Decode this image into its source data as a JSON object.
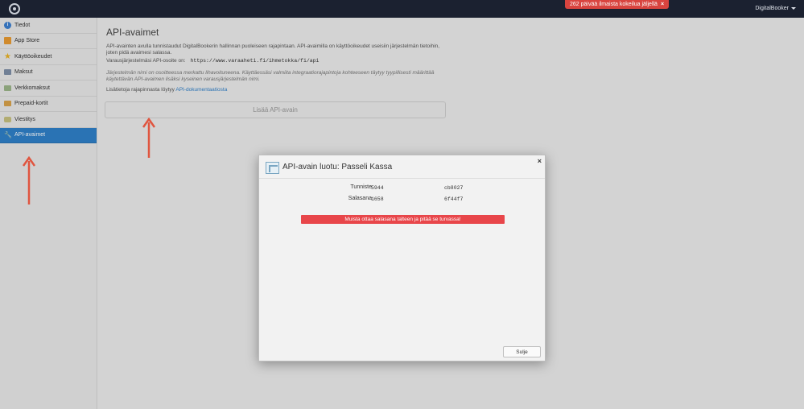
{
  "topbar": {
    "trial_notice": "262 päivää ilmaista kokeilua jäljellä",
    "trial_close": "×",
    "user_menu": "DigitalBooker"
  },
  "sidebar": {
    "items": [
      {
        "label": "Tiedot",
        "icon": "info-icon"
      },
      {
        "label": "App Store",
        "icon": "store-icon"
      },
      {
        "label": "Käyttöoikeudet",
        "icon": "star-icon"
      },
      {
        "label": "Maksut",
        "icon": "card-icon"
      },
      {
        "label": "Verkkomaksut",
        "icon": "card-icon"
      },
      {
        "label": "Prepaid-kortit",
        "icon": "card-icon"
      },
      {
        "label": "Viestitys",
        "icon": "message-icon"
      },
      {
        "label": "API-avaimet",
        "icon": "key-icon"
      }
    ]
  },
  "main": {
    "title": "API-avaimet",
    "intro": "API-avainten avulla tunnistaudut DigitalBookerin hallinnan puoleiseen rajapintaan. API-avaimilla on käyttöoikeudet useisiin järjestelmän tietoihin, joten pidä avaimesi salassa.",
    "url_label": "Varausjärjestelmäsi API-osoite on:",
    "url_value": "https://www.varaaheti.fi/ihmetokka/fi/api",
    "note": "Järjestelmän nimi on osoitteessa merkattu lihavoituneena. Käyttäessäsi valmiita integraatiorajapintoja kohteeseen täytyy tyypillisesti määrittää käytettävän API-avaimen lisäksi kyseinen varausjärjestelmän nimi.",
    "docs_text": "Lisätietoja rajapinnasta löytyy",
    "docs_link": "API-dokumentaatiosta",
    "add_button": "Lisää API-avain"
  },
  "modal": {
    "title": "API-avain luotu: Passeli Kassa",
    "tunniste_label": "Tunniste",
    "tunniste_start": "5944",
    "tunniste_end": "cb8027",
    "salasana_label": "Salasana",
    "salasana_start": "1658",
    "salasana_end": "6f44f7",
    "warning": "Muista ottaa salasana talteen ja pitää se turvassa!",
    "close_button": "Sulje",
    "close_x": "×"
  },
  "colors": {
    "topbar": "#1b2130",
    "active_nav": "#2f80c9",
    "warning": "#e8464a",
    "trial": "#d9443f",
    "arrow": "#e0553f"
  }
}
